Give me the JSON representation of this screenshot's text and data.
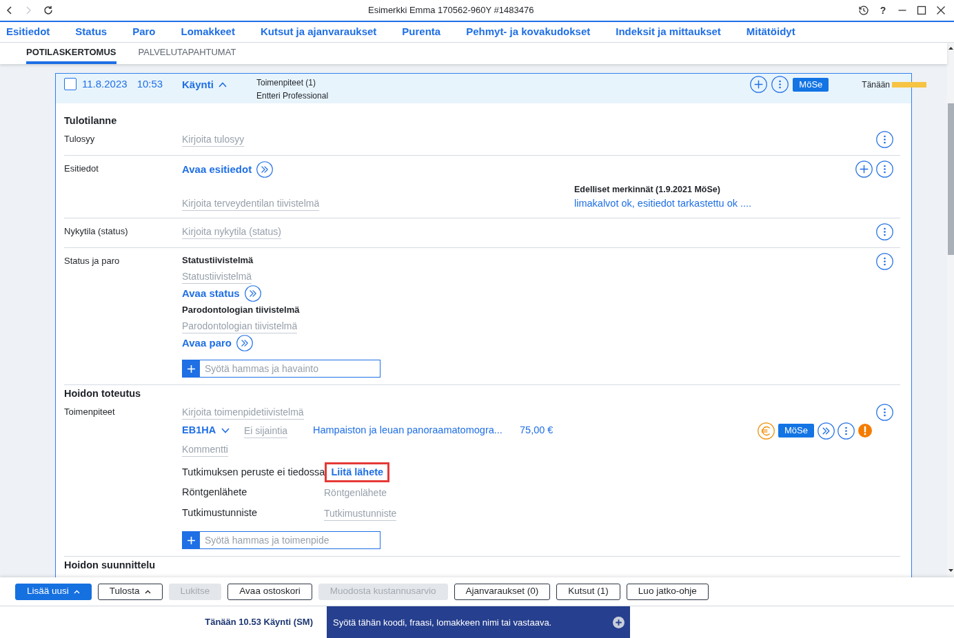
{
  "window": {
    "title": "Esimerkki Emma 170562-960Y #1483476",
    "can_go_forward": false,
    "help": "?"
  },
  "nav_tabs": [
    {
      "label": "Esitiedot",
      "selected": false
    },
    {
      "label": "Status",
      "selected": false
    },
    {
      "label": "Paro",
      "selected": false
    },
    {
      "label": "Lomakkeet",
      "selected": false
    },
    {
      "label": "Kutsut ja ajanvaraukset",
      "selected": false
    },
    {
      "label": "Purenta",
      "selected": false
    },
    {
      "label": "Pehmyt- ja kovakudokset",
      "selected": false
    },
    {
      "label": "Indeksit ja mittaukset",
      "selected": false
    },
    {
      "label": "Mitätöidyt",
      "selected": false
    }
  ],
  "sub_tabs": [
    {
      "label": "POTILASKERTOMUS",
      "selected": true
    },
    {
      "label": "PALVELUTAPAHTUMAT",
      "selected": false
    }
  ],
  "visit": {
    "checked": false,
    "date": "11.8.2023",
    "time": "10:53",
    "type": "Käynti",
    "expanded": true,
    "summary": "Toimenpiteet (1)",
    "system": "Entteri Professional",
    "author": "MöSe",
    "day": "Tänään"
  },
  "sections": [
    {
      "heading": "Tulotilanne",
      "rows": [
        {
          "label": "Tulosyy",
          "actions": [
            {
              "kind": "menu"
            }
          ],
          "items": [
            {
              "kind": "field",
              "placeholder": "Kirjoita tulosyy"
            }
          ]
        },
        {
          "label": "Esitiedot",
          "actions": [
            {
              "kind": "add"
            },
            {
              "kind": "menu"
            }
          ],
          "items": [
            {
              "kind": "link",
              "text": "Avaa esitiedot"
            },
            {
              "kind": "field",
              "placeholder": "Kirjoita terveydentilan tiivistelmä",
              "history": {
                "title": "Edelliset merkinnät (1.9.2021 MöSe)",
                "text": "limakalvot ok, esitiedot tarkastettu ok ...."
              }
            }
          ]
        },
        {
          "label": "Nykytila (status)",
          "actions": [
            {
              "kind": "menu"
            }
          ],
          "items": [
            {
              "kind": "field",
              "placeholder": "Kirjoita nykytila (status)"
            }
          ]
        },
        {
          "label": "Status ja paro",
          "actions": [
            {
              "kind": "menu"
            }
          ],
          "items": [
            {
              "kind": "subheading",
              "text": "Statustiivistelmä"
            },
            {
              "kind": "field",
              "placeholder": "Statustiivistelmä"
            },
            {
              "kind": "link",
              "text": "Avaa status"
            },
            {
              "kind": "subheading",
              "text": "Parodontologian tiivistelmä"
            },
            {
              "kind": "field",
              "placeholder": "Parodontologian tiivistelmä"
            },
            {
              "kind": "link",
              "text": "Avaa paro"
            },
            {
              "kind": "entry",
              "placeholder": "Syötä hammas ja havainto"
            }
          ]
        }
      ]
    },
    {
      "heading": "Hoidon toteutus",
      "rows": [
        {
          "label": "Toimenpiteet",
          "actions": [
            {
              "kind": "menu"
            }
          ],
          "items": [
            {
              "kind": "field",
              "placeholder": "Kirjoita toimenpidetiivistelmä"
            },
            {
              "kind": "procedure",
              "code": "EB1HA",
              "location": {
                "placeholder": "Ei sijaintia"
              },
              "name": "Hampaiston ja leuan panoraamatomogra...",
              "price": "75,00 €",
              "author": "MöSe"
            },
            {
              "kind": "field",
              "placeholder": "Kommentti"
            },
            {
              "kind": "notice",
              "text": "Tutkimuksen peruste ei tiedossa",
              "link": "Liitä lähete",
              "highlighted": true
            },
            {
              "kind": "pair",
              "label": "Röntgenlähete",
              "field": {
                "kind": "select",
                "placeholder": "Röntgenlähete"
              }
            },
            {
              "kind": "pair",
              "label": "Tutkimustunniste",
              "field": {
                "kind": "text",
                "placeholder": "Tutkimustunniste"
              }
            },
            {
              "kind": "entry",
              "placeholder": "Syötä hammas ja toimenpide"
            }
          ]
        }
      ]
    },
    {
      "heading": "Hoidon suunnittelu"
    }
  ],
  "toolbar": [
    {
      "label": "Lisää uusi",
      "primary": true,
      "menu": true,
      "disabled": false
    },
    {
      "label": "Tulosta",
      "primary": false,
      "menu": true,
      "disabled": false
    },
    {
      "label": "Lukitse",
      "primary": false,
      "menu": false,
      "disabled": true
    },
    {
      "label": "Avaa ostoskori",
      "primary": false,
      "menu": false,
      "disabled": false
    },
    {
      "label": "Muodosta kustannusarvio",
      "primary": false,
      "menu": false,
      "disabled": true
    },
    {
      "label": "Ajanvaraukset (0)",
      "primary": false,
      "menu": false,
      "disabled": false
    },
    {
      "label": "Kutsut (1)",
      "primary": false,
      "menu": false,
      "disabled": false
    },
    {
      "label": "Luo jatko-ohje",
      "primary": false,
      "menu": false,
      "disabled": false
    }
  ],
  "status_bar": {
    "context": "Tänään 10.53 Käynti (SM)",
    "command": {
      "placeholder": "Syötä tähän koodi, fraasi, lomakkeen nimi tai vastaava."
    }
  }
}
